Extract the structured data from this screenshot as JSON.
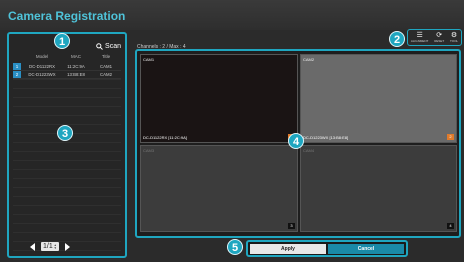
{
  "title": "Camera Registration",
  "scan": {
    "label": "Scan",
    "icon": "search-icon"
  },
  "list": {
    "headers": [
      "Model",
      "MAC",
      "Title"
    ],
    "rows": [
      {
        "index": "1",
        "model": "DC-D1122RX",
        "mac": "11:2C:9A",
        "title": "CAM1"
      },
      {
        "index": "2",
        "model": "DC-D1223WX",
        "mac": "13:B8:E8",
        "title": "CAM2"
      }
    ]
  },
  "pager": {
    "value": "1/1"
  },
  "channels_label": "Channels : 2 / Max : 4",
  "toolbar": [
    {
      "icon": "list-icon",
      "label": "ALIGNMENT"
    },
    {
      "icon": "reset-icon",
      "label": "RESET"
    },
    {
      "icon": "gear-icon",
      "label": "TOOL"
    }
  ],
  "cameras": [
    {
      "name": "CAM1",
      "caption": "DC-D1122RX [11:2C:9A]",
      "number": "1"
    },
    {
      "name": "CAM2",
      "caption": "DC-D1223WX [13:B8:E8]",
      "number": "2"
    },
    {
      "name": "CAM3",
      "caption": "",
      "number": "3"
    },
    {
      "name": "CAM4",
      "caption": "",
      "number": "4"
    }
  ],
  "buttons": {
    "apply": "Apply",
    "cancel": "Cancel"
  },
  "callouts": [
    "1",
    "2",
    "3",
    "4",
    "5"
  ],
  "colors": {
    "accent": "#1fa6c0",
    "title": "#4fc3d9",
    "active_number": "#e07a2a"
  }
}
